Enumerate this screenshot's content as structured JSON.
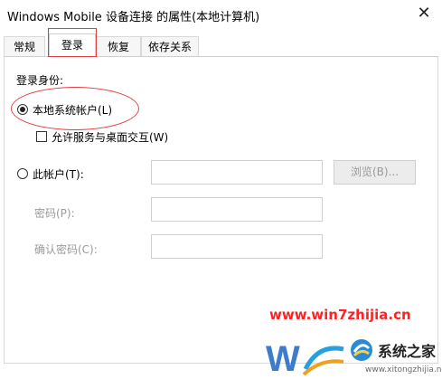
{
  "window": {
    "title": "Windows Mobile 设备连接 的属性(本地计算机)",
    "close_glyph": "✕"
  },
  "tabs": [
    {
      "label": "常规",
      "active": false
    },
    {
      "label": "登录",
      "active": true
    },
    {
      "label": "恢复",
      "active": false
    },
    {
      "label": "依存关系",
      "active": false
    }
  ],
  "logon": {
    "group_label": "登录身份:",
    "local_system_label": "本地系统帐户(L)",
    "local_system_selected": true,
    "allow_desktop_label": "允许服务与桌面交互(W)",
    "allow_desktop_checked": false,
    "this_account_label": "此帐户(T):",
    "this_account_selected": false,
    "account_value": "",
    "browse_label": "浏览(B)...",
    "password_label": "密码(P):",
    "password_value": "",
    "confirm_label": "确认密码(C):",
    "confirm_value": ""
  },
  "watermark": {
    "url": "www.win7zhijia.cn",
    "brand": "系统之家",
    "url2": "www.xitongzhijia.net",
    "url_color": "#ff2222"
  }
}
